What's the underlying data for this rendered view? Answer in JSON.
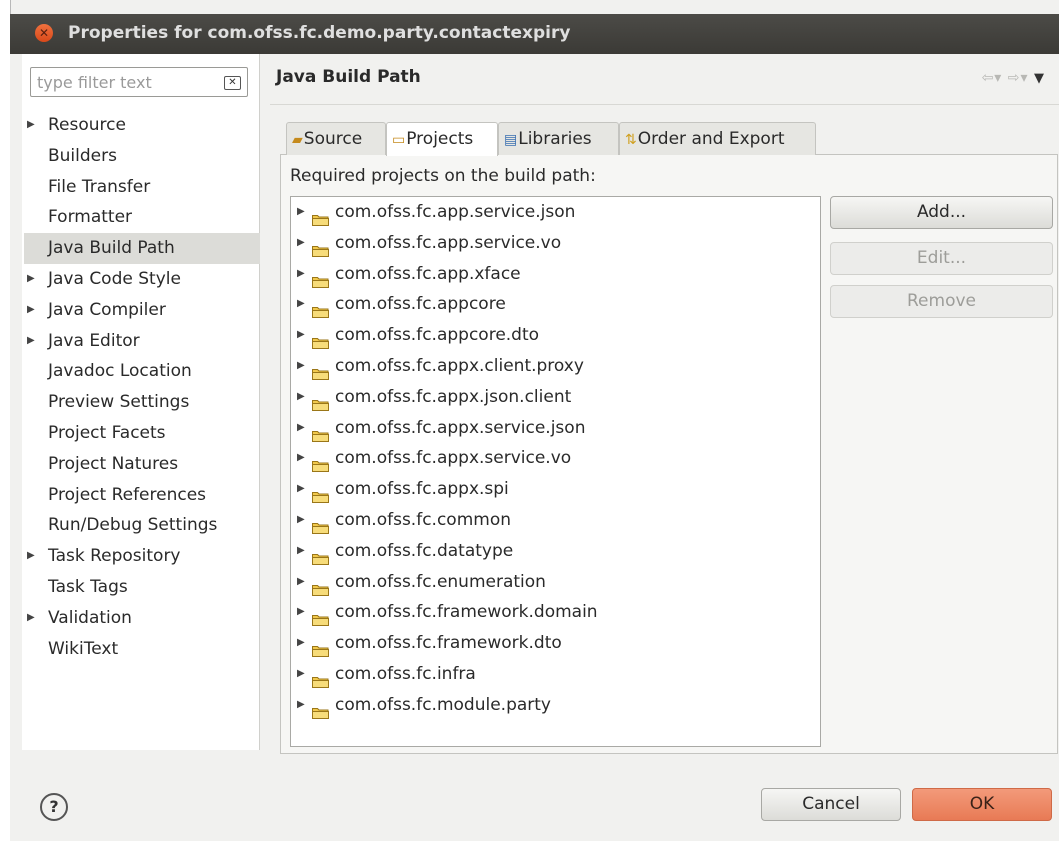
{
  "window": {
    "title": "Properties for com.ofss.fc.demo.party.contactexpiry"
  },
  "filter": {
    "placeholder": "type filter text"
  },
  "nav_tree": [
    {
      "label": "Resource",
      "expandable": true
    },
    {
      "label": "Builders",
      "expandable": false
    },
    {
      "label": "File Transfer",
      "expandable": false
    },
    {
      "label": "Formatter",
      "expandable": false
    },
    {
      "label": "Java Build Path",
      "expandable": false,
      "selected": true
    },
    {
      "label": "Java Code Style",
      "expandable": true
    },
    {
      "label": "Java Compiler",
      "expandable": true
    },
    {
      "label": "Java Editor",
      "expandable": true
    },
    {
      "label": "Javadoc Location",
      "expandable": false
    },
    {
      "label": "Preview Settings",
      "expandable": false
    },
    {
      "label": "Project Facets",
      "expandable": false
    },
    {
      "label": "Project Natures",
      "expandable": false
    },
    {
      "label": "Project References",
      "expandable": false
    },
    {
      "label": "Run/Debug Settings",
      "expandable": false
    },
    {
      "label": "Task Repository",
      "expandable": true
    },
    {
      "label": "Task Tags",
      "expandable": false
    },
    {
      "label": "Validation",
      "expandable": true
    },
    {
      "label": "WikiText",
      "expandable": false
    }
  ],
  "page": {
    "title": "Java Build Path"
  },
  "tabs": [
    {
      "label": "Source",
      "icon": "source-icon",
      "active": false
    },
    {
      "label": "Projects",
      "icon": "projects-icon",
      "active": true
    },
    {
      "label": "Libraries",
      "icon": "libraries-icon",
      "active": false
    },
    {
      "label": "Order and Export",
      "icon": "order-export-icon",
      "active": false
    }
  ],
  "projects": {
    "label": "Required projects on the build path:",
    "items": [
      "com.ofss.fc.app.service.json",
      "com.ofss.fc.app.service.vo",
      "com.ofss.fc.app.xface",
      "com.ofss.fc.appcore",
      "com.ofss.fc.appcore.dto",
      "com.ofss.fc.appx.client.proxy",
      "com.ofss.fc.appx.json.client",
      "com.ofss.fc.appx.service.json",
      "com.ofss.fc.appx.service.vo",
      "com.ofss.fc.appx.spi",
      "com.ofss.fc.common",
      "com.ofss.fc.datatype",
      "com.ofss.fc.enumeration",
      "com.ofss.fc.framework.domain",
      "com.ofss.fc.framework.dto",
      "com.ofss.fc.infra",
      "com.ofss.fc.module.party"
    ]
  },
  "buttons": {
    "add": "Add...",
    "edit": "Edit...",
    "remove": "Remove",
    "cancel": "Cancel",
    "ok": "OK"
  },
  "help": {
    "glyph": "?"
  },
  "colors": {
    "ok_button": "#e87a55",
    "titlebar": "#3b3a36",
    "selection": "#dcdcd8"
  }
}
